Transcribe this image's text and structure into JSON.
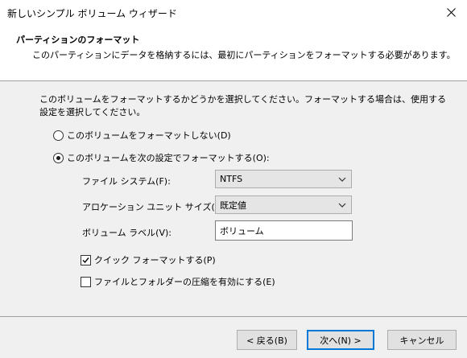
{
  "window": {
    "title": "新しいシンプル ボリューム ウィザード"
  },
  "header": {
    "title": "パーティションのフォーマット",
    "subtitle": "このパーティションにデータを格納するには、最初にパーティションをフォーマットする必要があります。"
  },
  "description": "このボリュームをフォーマットするかどうかを選択してください。フォーマットする場合は、使用する設定を選択してください。",
  "options": {
    "no_format": {
      "label": "このボリュームをフォーマットしない(D)",
      "selected": false
    },
    "format": {
      "label": "このボリュームを次の設定でフォーマットする(O):",
      "selected": true
    }
  },
  "fields": {
    "file_system": {
      "label": "ファイル システム(F):",
      "value": "NTFS"
    },
    "allocation_unit": {
      "label": "アロケーション ユニット サイズ(A):",
      "value": "既定値"
    },
    "volume_label": {
      "label": "ボリューム ラベル(V):",
      "value": "ボリューム"
    }
  },
  "checkboxes": {
    "quick_format": {
      "label": "クイック フォーマットする(P)",
      "checked": true
    },
    "compression": {
      "label": "ファイルとフォルダーの圧縮を有効にする(E)",
      "checked": false
    }
  },
  "buttons": {
    "back": "< 戻る(B)",
    "next": "次へ(N) >",
    "cancel": "キャンセル"
  },
  "icons": {
    "close": "close-icon",
    "dropdown": "chevron-down-icon",
    "check": "checkmark-icon"
  }
}
